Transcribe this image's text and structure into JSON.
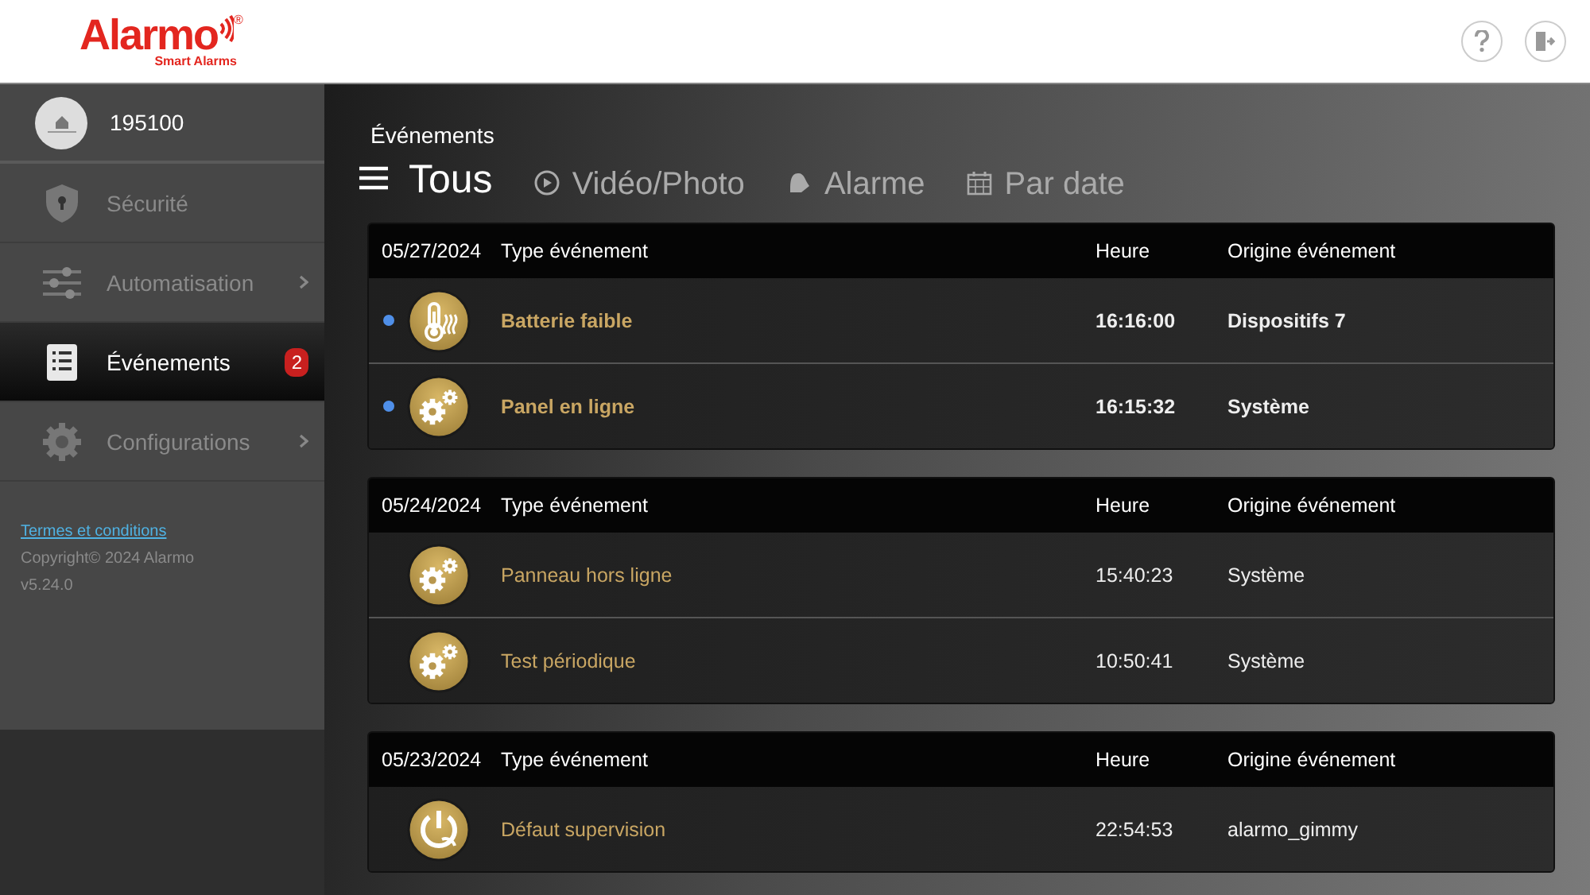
{
  "header": {
    "logo": "Alarmo",
    "logo_tagline": "Smart Alarms",
    "logo_mark": "®"
  },
  "sidebar": {
    "account": {
      "name": "195100"
    },
    "items": [
      {
        "label": "Sécurité",
        "kind": "shield",
        "selected": false,
        "has_submenu": false
      },
      {
        "label": "Automatisation",
        "kind": "sliders",
        "selected": false,
        "has_submenu": true
      },
      {
        "label": "Événements",
        "kind": "list",
        "selected": true,
        "has_submenu": false,
        "badge": "2"
      },
      {
        "label": "Configurations",
        "kind": "gear",
        "selected": false,
        "has_submenu": true
      }
    ],
    "terms_link": "Termes et conditions",
    "copyright": "Copyright© 2024 Alarmo",
    "version": "v5.24.0"
  },
  "main": {
    "title": "Événements",
    "tabs": [
      {
        "label": "Tous",
        "kind": "menu",
        "selected": true
      },
      {
        "label": "Vidéo/Photo",
        "kind": "play",
        "selected": false
      },
      {
        "label": "Alarme",
        "kind": "bell",
        "selected": false
      },
      {
        "label": "Par date",
        "kind": "calendar",
        "selected": false
      }
    ],
    "groups": [
      {
        "date": "05/27/2024",
        "columns": [
          "Type événement",
          "Heure",
          "Origine événement"
        ],
        "rows": [
          {
            "kind": "thermometer",
            "event": "Batterie faible",
            "time": "16:16:00",
            "origin": "Dispositifs 7",
            "unread": true
          },
          {
            "kind": "gears",
            "event": "Panel en ligne",
            "time": "16:15:32",
            "origin": "Système",
            "unread": true
          }
        ]
      },
      {
        "date": "05/24/2024",
        "columns": [
          "Type événement",
          "Heure",
          "Origine événement"
        ],
        "rows": [
          {
            "kind": "gears",
            "event": "Panneau hors ligne",
            "time": "15:40:23",
            "origin": "Système",
            "unread": false
          },
          {
            "kind": "gears",
            "event": "Test périodique",
            "time": "10:50:41",
            "origin": "Système",
            "unread": false
          }
        ]
      },
      {
        "date": "05/23/2024",
        "columns": [
          "Type événement",
          "Heure",
          "Origine événement"
        ],
        "rows": [
          {
            "kind": "power",
            "event": "Défaut supervision",
            "time": "22:54:53",
            "origin": "alarmo_gimmy",
            "unread": false
          }
        ]
      }
    ]
  }
}
